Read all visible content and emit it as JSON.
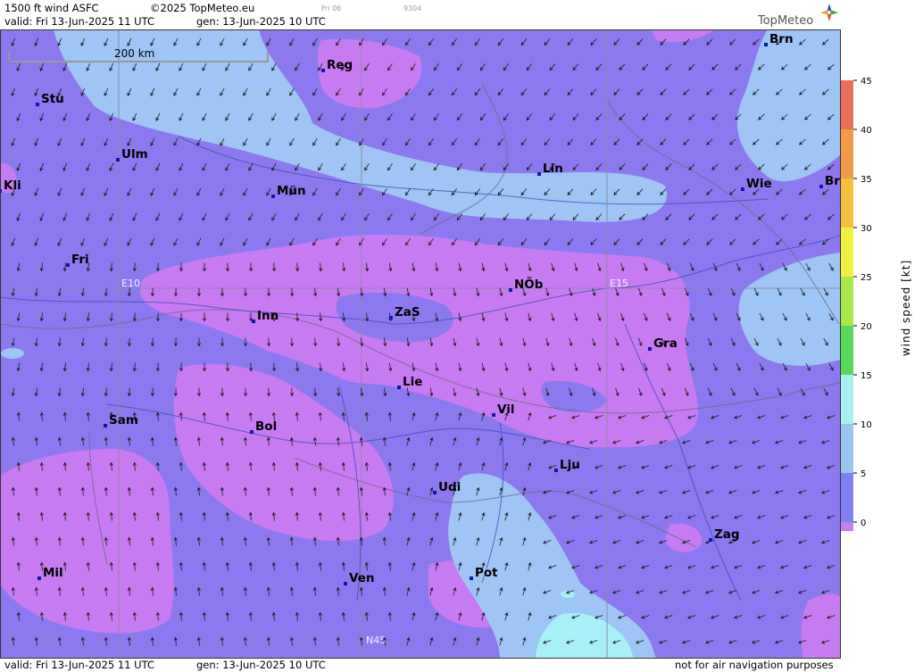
{
  "header": {
    "product": "1500 ft wind ASFC",
    "copyright": "©2025 TopMeteo.eu",
    "valid": "valid:  Fri  13-Jun-2025  11 UTC",
    "generated": "gen: 13-Jun-2025 10 UTC",
    "run_tag": "Fri 06",
    "code": "9304"
  },
  "logo": {
    "text": "TopMeteo"
  },
  "footer": {
    "valid": "valid:  Fri  13-Jun-2025  11 UTC",
    "generated": "gen: 13-Jun-2025 10 UTC",
    "disclaimer": "not for air navigation purposes"
  },
  "map": {
    "scale_label": "200 km",
    "grid_labels": [
      "E10",
      "E15",
      "N45"
    ],
    "cities": [
      {
        "name": "Brn"
      },
      {
        "name": "Reg"
      },
      {
        "name": "Stu"
      },
      {
        "name": "Ulm"
      },
      {
        "name": "Lin"
      },
      {
        "name": "Mün"
      },
      {
        "name": "Kli"
      },
      {
        "name": "Wie"
      },
      {
        "name": "Br"
      },
      {
        "name": "Fri"
      },
      {
        "name": "NÖb"
      },
      {
        "name": "Inn"
      },
      {
        "name": "ZaS"
      },
      {
        "name": "Gra"
      },
      {
        "name": "Lie"
      },
      {
        "name": "Vil"
      },
      {
        "name": "Sam"
      },
      {
        "name": "Bol"
      },
      {
        "name": "Lju"
      },
      {
        "name": "Udi"
      },
      {
        "name": "Zag"
      },
      {
        "name": "Mil"
      },
      {
        "name": "Ven"
      },
      {
        "name": "Pot"
      }
    ]
  },
  "legend": {
    "title": "wind  speed  [kt]",
    "ticks": [
      "45",
      "40",
      "35",
      "30",
      "25",
      "20",
      "15",
      "10",
      "5",
      "0"
    ],
    "colors": [
      "#e8705a",
      "#f09a4a",
      "#f5c040",
      "#f0f040",
      "#a8e848",
      "#58d858",
      "#a8f0f0",
      "#98c8f0",
      "#8080f0",
      "#c080f0"
    ]
  },
  "colors": {
    "violet_light": "#c77bf2",
    "violet_mid": "#8d79ef",
    "blue_light": "#9ec5f3",
    "cyan": "#a8f0f5"
  }
}
